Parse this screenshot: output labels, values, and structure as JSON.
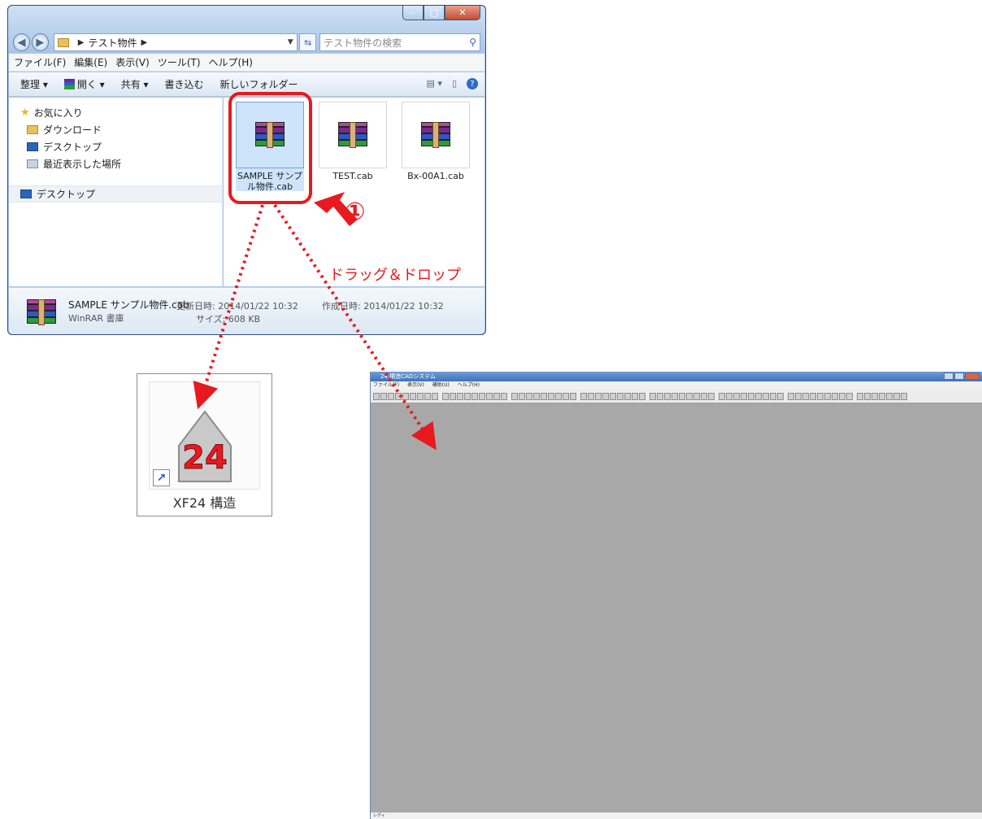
{
  "explorer": {
    "breadcrumb": "テスト物件",
    "search_placeholder": "テスト物件の検索",
    "menu": [
      "ファイル(F)",
      "編集(E)",
      "表示(V)",
      "ツール(T)",
      "ヘルプ(H)"
    ],
    "commands": [
      "整理 ▾",
      "開く ▾",
      "共有 ▾",
      "書き込む",
      "新しいフォルダー"
    ],
    "nav": {
      "favorites": "お気に入り",
      "downloads": "ダウンロード",
      "desktop": "デスクトップ",
      "recent": "最近表示した場所",
      "desktop_root": "デスクトップ"
    },
    "files": [
      {
        "name_line1": "SAMPLE サンプ",
        "name_line2": "ル物件.cab"
      },
      {
        "name_line1": "TEST.cab",
        "name_line2": ""
      },
      {
        "name_line1": "Bx-00A1.cab",
        "name_line2": ""
      }
    ],
    "details": {
      "name": "SAMPLE サンプル物件.cab",
      "type": "WinRAR 書庫",
      "modified": "更新日時: 2014/01/22 10:32",
      "size": "サイズ: 608 KB",
      "created": "作成日時: 2014/01/22 10:32"
    }
  },
  "annotations": {
    "step": "①",
    "drag_drop": "ドラッグ＆ドロップ",
    "color": "#e8191f"
  },
  "shortcut": {
    "number": "24",
    "label": "XF24 構造"
  },
  "cad": {
    "title": "24 構造CADシステム",
    "menu": [
      "ファイル(F)",
      "表示(V)",
      "補助(U)",
      "ヘルプ(H)"
    ],
    "status": "レディ"
  }
}
